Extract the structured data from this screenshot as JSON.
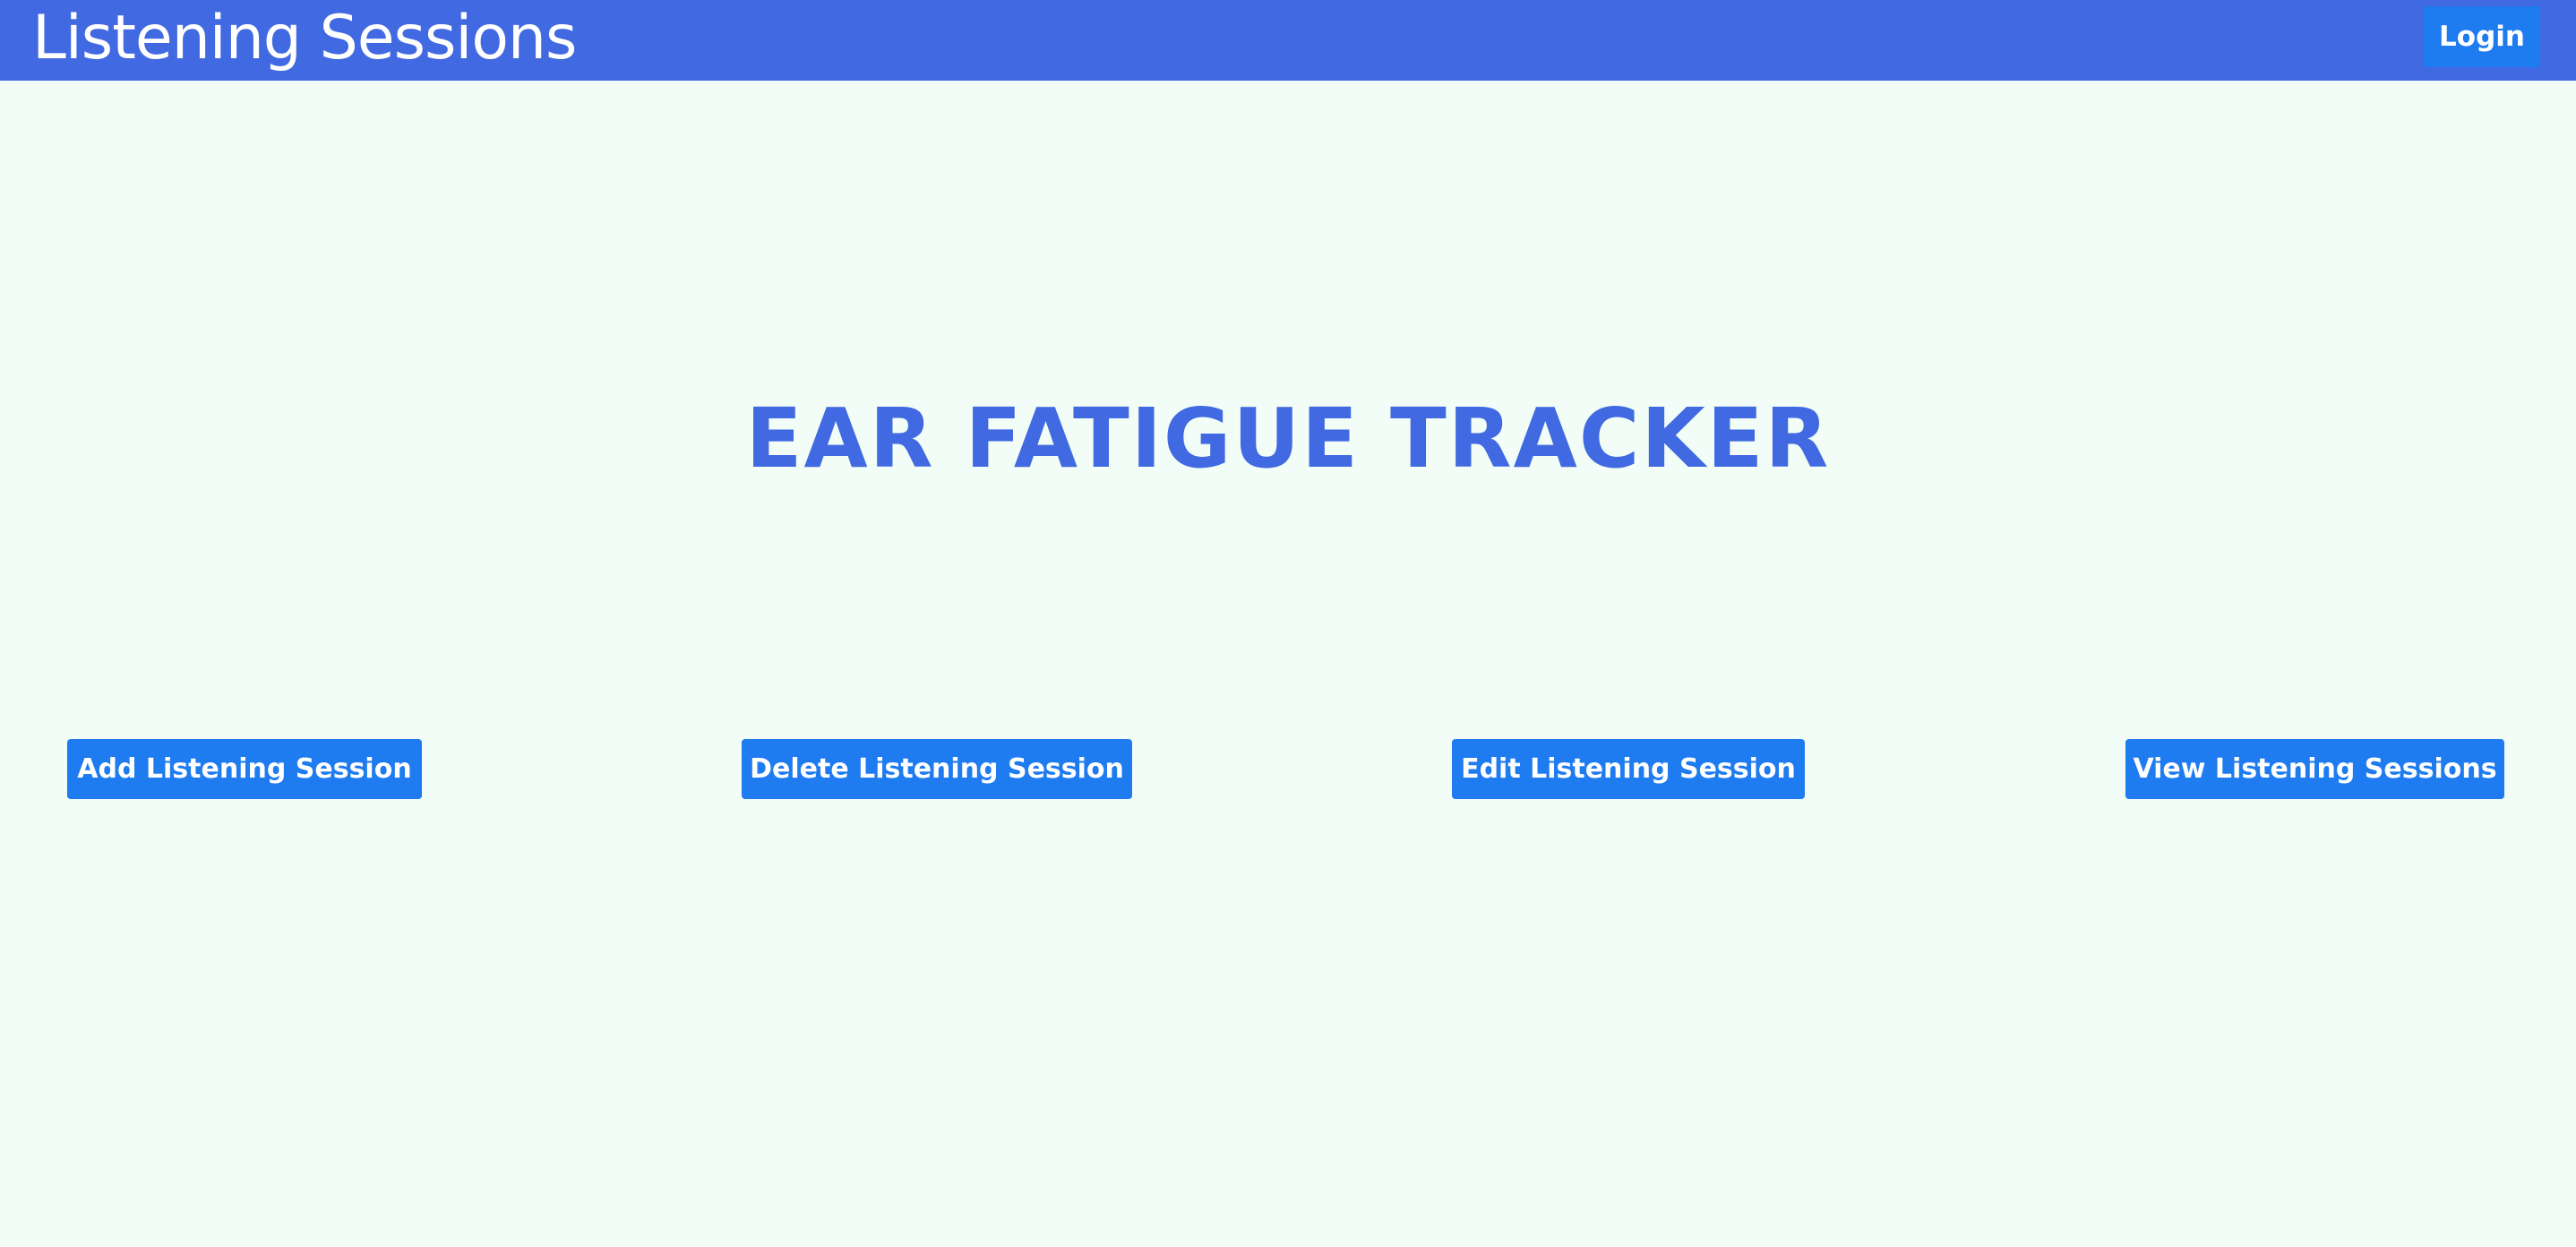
{
  "navbar": {
    "title": "Listening Sessions",
    "login_label": "Login",
    "background_color": "#4169e1"
  },
  "hero": {
    "title": "EAR FATIGUE TRACKER",
    "color": "#4169e1"
  },
  "actions": {
    "add_label": "Add Listening Session",
    "delete_label": "Delete Listening Session",
    "edit_label": "Edit Listening Session",
    "view_label": "View Listening Sessions",
    "button_color": "#1e7bf0"
  },
  "page": {
    "background_color": "#f2fdf7"
  }
}
